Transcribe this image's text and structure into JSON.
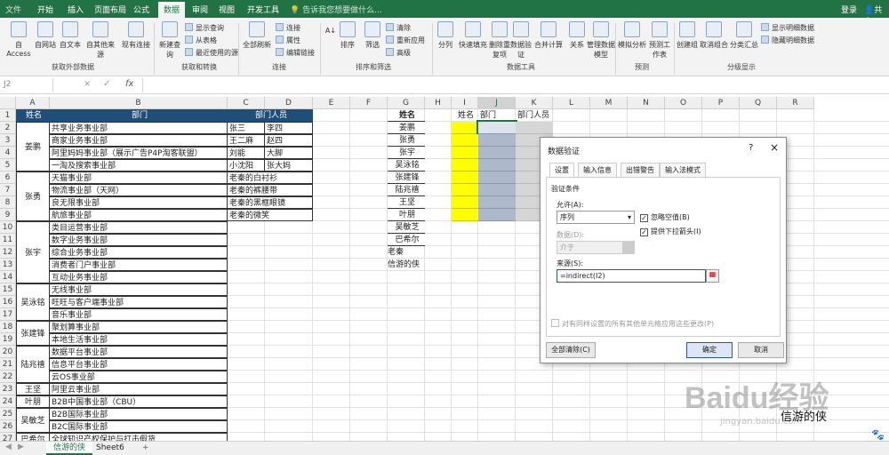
{
  "menu": {
    "file": "文件",
    "tabs": [
      "开始",
      "插入",
      "页面布局",
      "公式",
      "数据",
      "审阅",
      "视图",
      "开发工具"
    ],
    "tell_me": "告诉我您想要做什么...",
    "login": "登录",
    "share": "共享"
  },
  "ribbon": {
    "get_external": [
      "自 Access",
      "自网站",
      "自文本",
      "自其他来源",
      "现有连接"
    ],
    "get_external_group": "获取外部数据",
    "new_query": "新建查询",
    "query_small": [
      "显示查询",
      "从表格",
      "最近使用的源"
    ],
    "transform_group": "获取和转换",
    "refresh": "全部刷新",
    "conn_small": [
      "连接",
      "属性",
      "编辑链接"
    ],
    "conn_group": "连接",
    "sort_az": "排序",
    "filter": "筛选",
    "filter_small": [
      "清除",
      "重新应用",
      "高级"
    ],
    "sort_group": "排序和筛选",
    "tools": [
      "分列",
      "快速填充",
      "删除重复项",
      "数据验证",
      "合并计算",
      "关系",
      "管理数据模型"
    ],
    "tools_group": "数据工具",
    "forecast": [
      "模拟分析",
      "预测工作表"
    ],
    "forecast_group": "预测",
    "outline": [
      "创建组",
      "取消组合",
      "分类汇总"
    ],
    "outline_small": [
      "显示明细数据",
      "隐藏明细数据"
    ],
    "outline_group": "分级显示"
  },
  "formula_bar": {
    "name_box": "J2",
    "fx": "fx",
    "cancel": "×",
    "confirm": "✓"
  },
  "columns": [
    "A",
    "B",
    "C",
    "D",
    "E",
    "F",
    "G",
    "H",
    "I",
    "J",
    "K",
    "L",
    "M",
    "N",
    "O",
    "P",
    "Q",
    "R"
  ],
  "rows": [
    "1",
    "2",
    "3",
    "4",
    "5",
    "6",
    "7",
    "8",
    "9",
    "10",
    "11",
    "12",
    "13",
    "14",
    "15",
    "16",
    "17",
    "18",
    "19",
    "20",
    "21",
    "22",
    "23",
    "24",
    "25",
    "26",
    "27"
  ],
  "table1": {
    "h_name": "姓名",
    "h_dept": "部门",
    "h_staff": "部门人员",
    "names": [
      {
        "name": "姜鹏",
        "row": 2,
        "span": 4
      },
      {
        "name": "张勇",
        "row": 6,
        "span": 4
      },
      {
        "name": "张宇",
        "row": 10,
        "span": 5
      },
      {
        "name": "吴泳铭",
        "row": 15,
        "span": 3
      },
      {
        "name": "张建锋",
        "row": 18,
        "span": 2
      },
      {
        "name": "陆兆禧",
        "row": 20,
        "span": 3
      },
      {
        "name": "王坚",
        "row": 23,
        "span": 1
      },
      {
        "name": "叶朋",
        "row": 24,
        "span": 1
      },
      {
        "name": "吴敏芝",
        "row": 25,
        "span": 2
      },
      {
        "name": "巴希尔",
        "row": 27,
        "span": 1
      }
    ],
    "depts": [
      "共享业务事业部",
      "商家业务事业部",
      "阿里妈妈事业部（展示广告P4P淘客联盟）",
      "一淘及搜索事业部",
      "天猫事业部",
      "物流事业部（天网）",
      "良无限事业部",
      "航旅事业部",
      "类目运营事业部",
      "数字业务事业部",
      "综合业务事业部",
      "消费者门户事业部",
      "互动业务事业部",
      "无线事业部",
      "旺旺与客户端事业部",
      "音乐事业部",
      "聚划算事业部",
      "本地生活事业部",
      "数据平台事业部",
      "信息平台事业部",
      "云OS事业部",
      "阿里云事业部",
      "B2B中国事业部（CBU）",
      "B2B国际事业部",
      "B2C国际事业部",
      "全球知识产权保护与打击假货"
    ],
    "staff": [
      [
        "张三",
        "李四"
      ],
      [
        "王二麻",
        "赵四"
      ],
      [
        "刘能",
        "大脚"
      ],
      [
        "小沈阳",
        "张大妈"
      ]
    ],
    "staff_wide": [
      "老秦的白衬衫",
      "老秦的裤腰带",
      "老秦的黑框眼镜",
      "老秦的微笑"
    ]
  },
  "table2": {
    "header": "姓名",
    "names": [
      "姜鹏",
      "张勇",
      "张宇",
      "吴泳铭",
      "张建锋",
      "陆兆禧",
      "王坚",
      "叶朋",
      "吴敏芝",
      "巴希尔"
    ],
    "extra": [
      "老秦",
      "信游的侠"
    ]
  },
  "table3": {
    "h_name": "姓名",
    "h_dept": "部门",
    "h_staff": "部门人员"
  },
  "dialog": {
    "title": "数据验证",
    "help": "?",
    "close": "×",
    "tabs": [
      "设置",
      "输入信息",
      "出错警告",
      "输入法模式"
    ],
    "criteria": "验证条件",
    "allow_label": "允许(A):",
    "allow_value": "序列",
    "ignore_blank": "忽略空值(B)",
    "dropdown": "提供下拉箭头(I)",
    "data_label": "数据(D):",
    "data_value": "介于",
    "source_label": "来源(S):",
    "source_value": "=indirect(I2)",
    "apply_all": "对有同样设置的所有其他单元格应用这些更改(P)",
    "clear_all": "全部清除(C)",
    "ok": "确定",
    "cancel": "取消"
  },
  "sheets": [
    "信游的侠",
    "Sheet6"
  ],
  "add_sheet": "+",
  "watermark": {
    "logo": "Baidu经验",
    "url": "jingyan.baidu.com",
    "author": "信游的侠"
  },
  "colors": {
    "excel_green": "#217346",
    "header_blue": "#1f4e79",
    "yellow": "#ffff00",
    "gray_cell": "#adb9ca"
  }
}
